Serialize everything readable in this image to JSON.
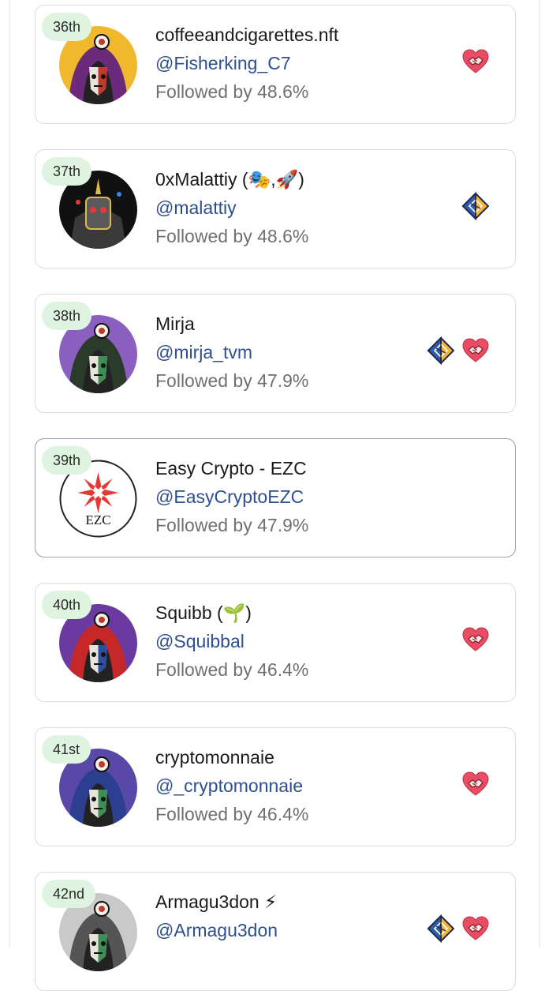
{
  "accounts": [
    {
      "rank": "36th",
      "name": "coffeeandcigarettes.nft",
      "handle": "@Fisherking_C7",
      "followed": "Followed by 48.6%",
      "avatar_style": "gold-hood",
      "badges": [
        "handshake-icon"
      ],
      "selected": false
    },
    {
      "rank": "37th",
      "name": "0xMalattiy (🎭,🚀)",
      "handle": "@malattiy",
      "followed": "Followed by 48.6%",
      "avatar_style": "dark-robot",
      "badges": [
        "diamond-badge-icon"
      ],
      "selected": false
    },
    {
      "rank": "38th",
      "name": "Mirja",
      "handle": "@mirja_tvm",
      "followed": "Followed by 47.9%",
      "avatar_style": "purple-hood",
      "badges": [
        "diamond-badge-icon",
        "handshake-icon"
      ],
      "selected": false
    },
    {
      "rank": "39th",
      "name": "Easy Crypto - EZC",
      "handle": "@EasyCryptoEZC",
      "followed": "Followed by 47.9%",
      "avatar_style": "ezc-logo",
      "avatar_text": "EZC",
      "badges": [],
      "selected": true
    },
    {
      "rank": "40th",
      "name": "Squibb (🌱)",
      "handle": "@Squibbal",
      "followed": "Followed by 46.4%",
      "avatar_style": "red-hood",
      "badges": [
        "handshake-icon"
      ],
      "selected": false
    },
    {
      "rank": "41st",
      "name": "cryptomonnaie",
      "handle": "@_cryptomonnaie",
      "followed": "Followed by 46.4%",
      "avatar_style": "blue-hood",
      "badges": [
        "handshake-icon"
      ],
      "selected": false
    },
    {
      "rank": "42nd",
      "name": "Armagu3don ⚡",
      "handle": "@Armagu3don",
      "followed": "",
      "avatar_style": "grey-hood",
      "badges": [
        "diamond-badge-icon",
        "handshake-icon"
      ],
      "selected": false
    }
  ],
  "colors": {
    "rank_bg": "#dff3e1",
    "handle": "#2e4f8f",
    "followed": "#707070",
    "heart": "#e94c64",
    "selected_border": "#9a9cb4"
  }
}
